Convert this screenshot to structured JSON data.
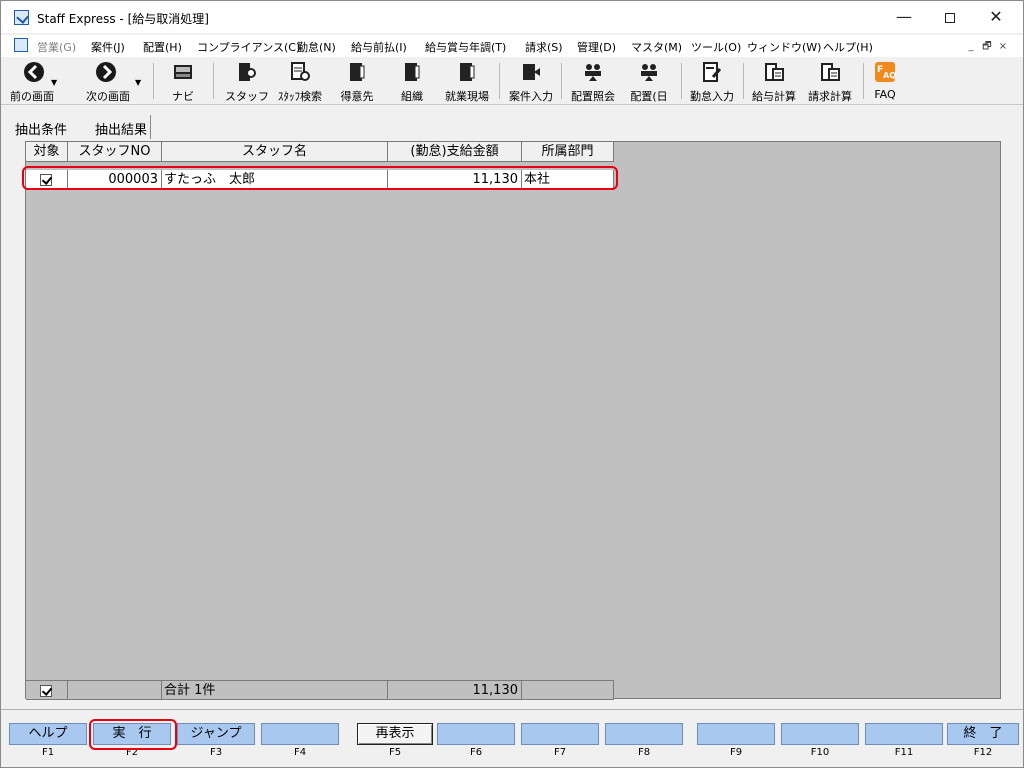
{
  "window": {
    "title": "Staff Express - [給与取消処理]",
    "controls": {
      "minimize": "—",
      "close": "✕"
    }
  },
  "menu": {
    "items": [
      {
        "label": "営業(G)",
        "enabled": false
      },
      {
        "label": "案件(J)",
        "enabled": true
      },
      {
        "label": "配置(H)",
        "enabled": true
      },
      {
        "label": "コンプライアンス(C)",
        "enabled": true
      },
      {
        "label": "勤怠(N)",
        "enabled": true
      },
      {
        "label": "給与前払(I)",
        "enabled": true
      },
      {
        "label": "給与賞与年調(T)",
        "enabled": true
      },
      {
        "label": "請求(S)",
        "enabled": true
      },
      {
        "label": "管理(D)",
        "enabled": true
      },
      {
        "label": "マスタ(M)",
        "enabled": true
      },
      {
        "label": "ツール(O)",
        "enabled": true
      },
      {
        "label": "ウィンドウ(W)",
        "enabled": true
      },
      {
        "label": "ヘルプ(H)",
        "enabled": true
      }
    ],
    "mdi_controls": [
      "_",
      "🗗",
      "×"
    ]
  },
  "toolbar": {
    "items": [
      {
        "label": "前の画面",
        "icon": "back-arrow-icon"
      },
      {
        "label": "次の画面",
        "icon": "forward-arrow-icon"
      },
      {
        "label": "ナビ",
        "icon": "keyboard-icon"
      },
      {
        "label": "スタッフ",
        "icon": "staff-binder-icon"
      },
      {
        "label": "ｽﾀｯﾌ検索",
        "icon": "staff-search-icon"
      },
      {
        "label": "得意先",
        "icon": "client-binder-icon"
      },
      {
        "label": "組織",
        "icon": "organization-binder-icon"
      },
      {
        "label": "就業現場",
        "icon": "worksite-binder-icon"
      },
      {
        "label": "案件入力",
        "icon": "project-entry-icon"
      },
      {
        "label": "配置照会",
        "icon": "assignment-inquiry-icon"
      },
      {
        "label": "配置(日",
        "icon": "assignment-daily-icon"
      },
      {
        "label": "勤怠入力",
        "icon": "attendance-entry-icon"
      },
      {
        "label": "給与計算",
        "icon": "payroll-calc-icon"
      },
      {
        "label": "請求計算",
        "icon": "billing-calc-icon"
      },
      {
        "label": "FAQ",
        "icon": "faq-icon"
      }
    ]
  },
  "tabs": [
    {
      "label": "抽出条件",
      "active": false
    },
    {
      "label": "抽出結果",
      "active": true
    }
  ],
  "grid": {
    "columns": [
      "対象",
      "スタッフNO",
      "スタッフ名",
      "(勤怠)支給金額",
      "所属部門"
    ],
    "rows": [
      {
        "checked": true,
        "staff_no": "000003",
        "staff_name": "すたっふ　太郎",
        "amount": "11,130",
        "department": "本社"
      }
    ],
    "footer": {
      "checked": true,
      "summary": "合計 1件",
      "total_amount": "11,130"
    }
  },
  "function_keys": [
    {
      "key": "F1",
      "label": "ヘルプ"
    },
    {
      "key": "F2",
      "label": "実　行"
    },
    {
      "key": "F3",
      "label": "ジャンプ"
    },
    {
      "key": "F4",
      "label": ""
    },
    {
      "key": "F5",
      "label": "再表示"
    },
    {
      "key": "F6",
      "label": ""
    },
    {
      "key": "F7",
      "label": ""
    },
    {
      "key": "F8",
      "label": ""
    },
    {
      "key": "F9",
      "label": ""
    },
    {
      "key": "F10",
      "label": ""
    },
    {
      "key": "F11",
      "label": ""
    },
    {
      "key": "F12",
      "label": "終　了"
    }
  ],
  "colors": {
    "highlight": "#e60012",
    "fkey_bg": "#a8c8f0",
    "grid_bg": "#c0c0c0"
  }
}
